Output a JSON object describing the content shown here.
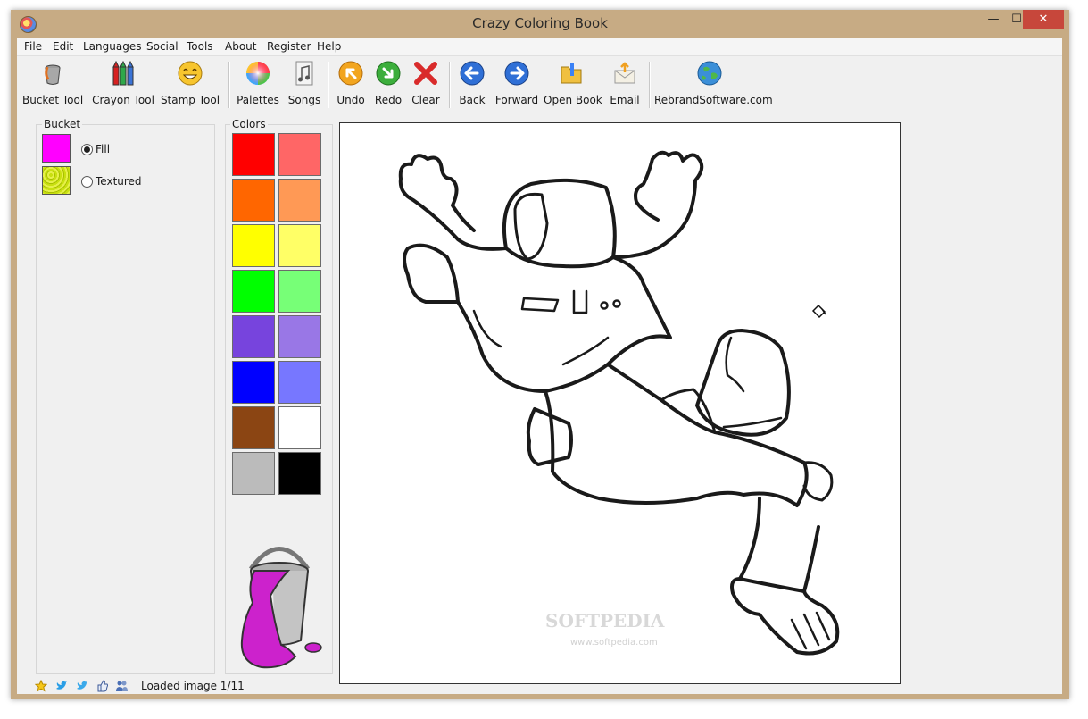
{
  "window": {
    "title": "Crazy Coloring Book",
    "minimize": "—",
    "maximize": "☐",
    "close": "✕"
  },
  "menu": [
    "File",
    "Edit",
    "Languages",
    "Social",
    "Tools",
    "About",
    "Register",
    "Help"
  ],
  "toolbar": {
    "bucket": "Bucket Tool",
    "crayon": "Crayon Tool",
    "stamp": "Stamp Tool",
    "palettes": "Palettes",
    "songs": "Songs",
    "undo": "Undo",
    "redo": "Redo",
    "clear": "Clear",
    "back": "Back",
    "forward": "Forward",
    "open_book": "Open Book",
    "email": "Email",
    "rebrand": "RebrandSoftware.com"
  },
  "bucket_panel": {
    "title": "Bucket",
    "fill_label": "Fill",
    "textured_label": "Textured",
    "fill_color": "#ff00ff",
    "mode": "fill"
  },
  "colors_panel": {
    "title": "Colors",
    "swatches": [
      "#ff0000",
      "#ff6666",
      "#ff6600",
      "#ff9955",
      "#ffff00",
      "#ffff66",
      "#00ff00",
      "#77ff77",
      "#7744dd",
      "#9977e6",
      "#0000ff",
      "#7777ff",
      "#8b4513",
      "#ffffff",
      "#bbbbbb",
      "#000000"
    ]
  },
  "status": {
    "text": "Loaded image 1/11"
  },
  "watermark": {
    "text": "SOFTPEDIA",
    "url": "www.softpedia.com"
  }
}
